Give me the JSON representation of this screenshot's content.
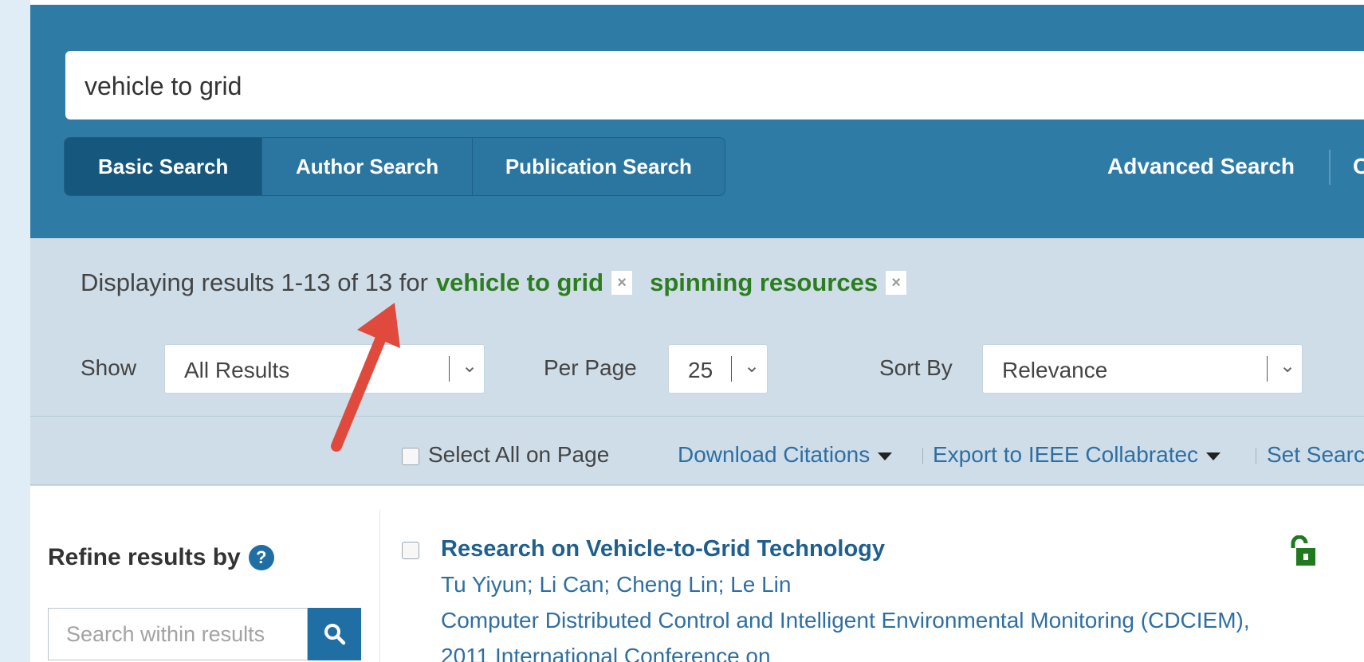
{
  "search": {
    "query": "vehicle to grid",
    "tabs": [
      "Basic Search",
      "Author Search",
      "Publication Search"
    ],
    "advanced_label": "Advanced Search",
    "advanced_trailing_fragment": "C"
  },
  "results": {
    "prefix": "Displaying results 1-13 of 13 for",
    "terms": [
      "vehicle to grid",
      "spinning resources"
    ],
    "remove_icon": "×",
    "show_label": "Show",
    "show_value": "All Results",
    "per_page_label": "Per Page",
    "per_page_value": "25",
    "sort_label": "Sort By",
    "sort_value": "Relevance"
  },
  "toolbar": {
    "select_all": "Select All on Page",
    "download": "Download Citations",
    "export": "Export to IEEE Collabratec",
    "set_search": "Set Searc"
  },
  "sidebar": {
    "refine_title": "Refine results by",
    "help_icon": "?",
    "within_placeholder": "Search within results"
  },
  "result_item": {
    "title": "Research on Vehicle-to-Grid Technology",
    "authors": "Tu Yiyun; Li Can; Cheng Lin; Le Lin",
    "publication_line1": "Computer Distributed Control and Intelligent Environmental Monitoring (CDCIEM),",
    "publication_line2": "2011 International Conference on"
  },
  "colors": {
    "header_bg": "#2e7ca6",
    "active_tab": "#15577d",
    "results_bg": "#cedde8",
    "term_green": "#2c7d1e",
    "link_blue": "#2e6fa3",
    "annotation_arrow": "#e04a3c",
    "open_access_green": "#1f7a1f"
  },
  "icons": {
    "search_button": "magnifier-icon",
    "open_access": "unlock-icon",
    "annotation": "red-arrow"
  }
}
